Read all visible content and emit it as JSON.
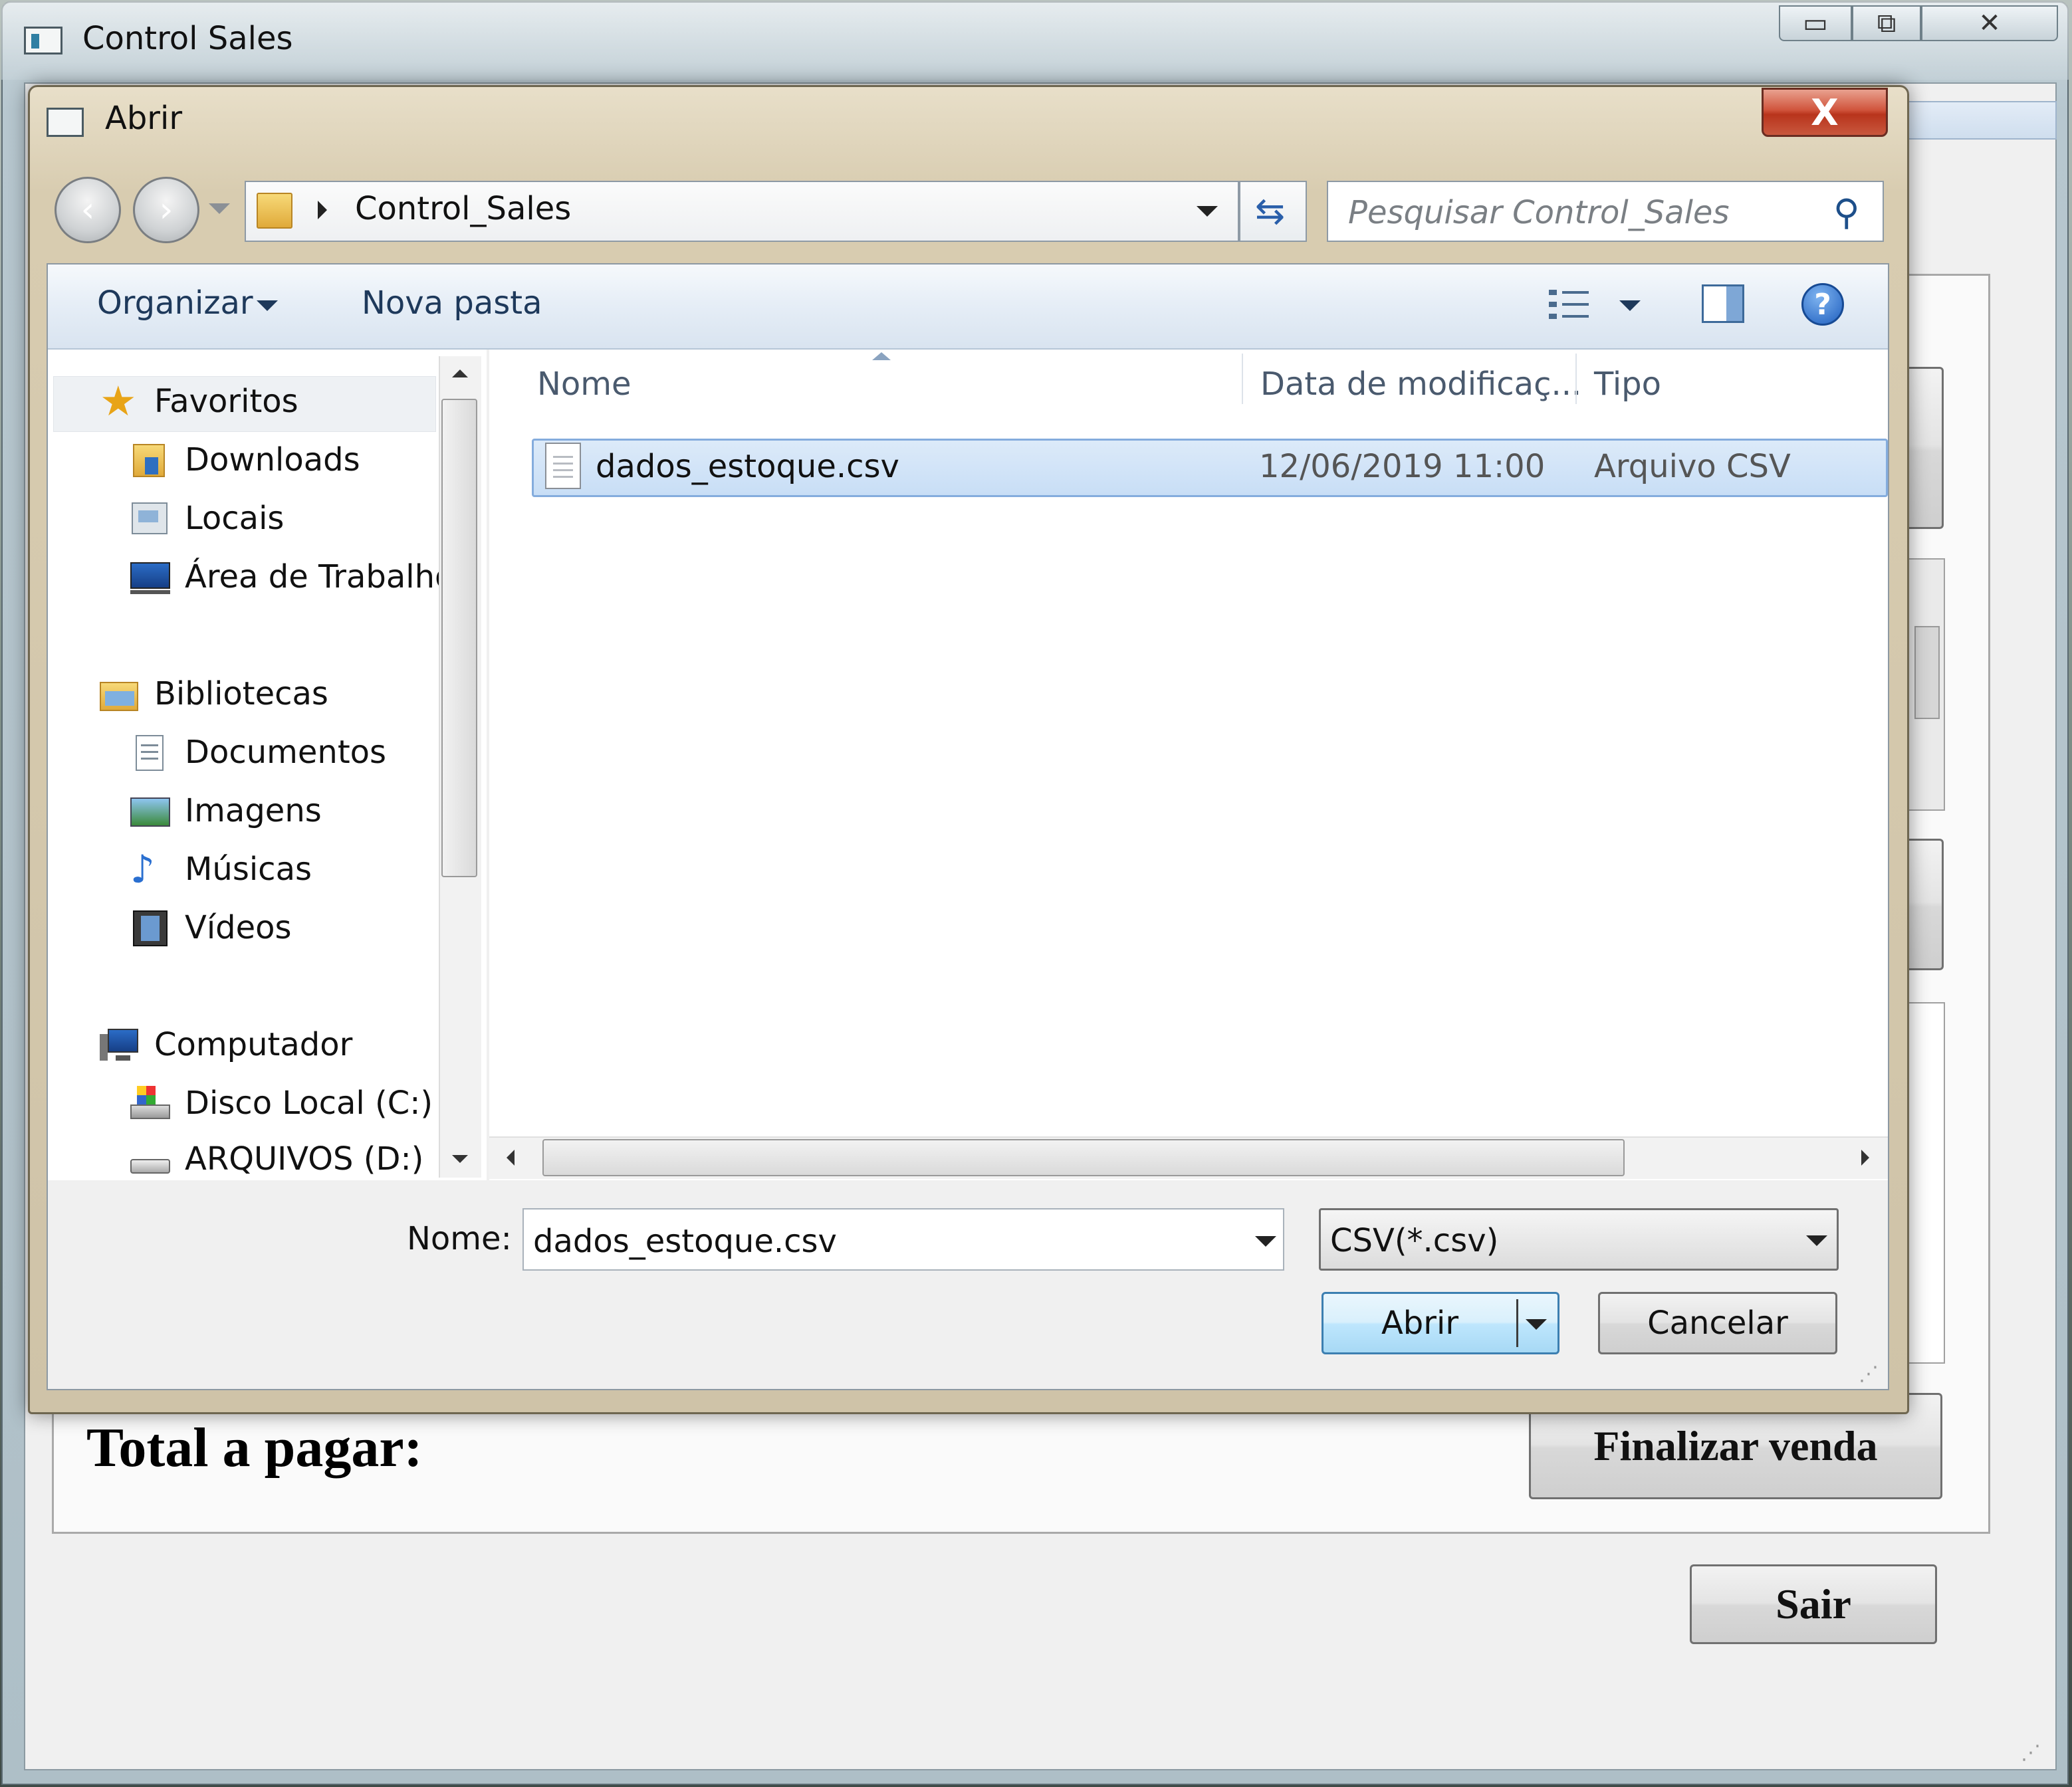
{
  "main_window": {
    "title": "Control Sales",
    "caption_buttons": {
      "minimize": "▭",
      "maximize": "⧉",
      "close": "✕"
    },
    "total_label": "Total a pagar:",
    "finalize_button": "Finalizar venda",
    "exit_button": "Sair"
  },
  "dialog": {
    "title": "Abrir",
    "close_glyph": "X",
    "breadcrumb": "Control_Sales",
    "search_placeholder": "Pesquisar Control_Sales",
    "toolbar": {
      "organize": "Organizar",
      "new_folder": "Nova pasta"
    },
    "nav": {
      "favorites": {
        "label": "Favoritos",
        "items": [
          "Downloads",
          "Locais",
          "Área de Trabalho"
        ]
      },
      "libraries": {
        "label": "Bibliotecas",
        "items": [
          "Documentos",
          "Imagens",
          "Músicas",
          "Vídeos"
        ]
      },
      "computer": {
        "label": "Computador",
        "items": [
          "Disco Local (C:)",
          "ARQUIVOS (D:)"
        ]
      }
    },
    "columns": {
      "name": "Nome",
      "date": "Data de modificaç...",
      "type": "Tipo"
    },
    "files": [
      {
        "name": "dados_estoque.csv",
        "date": "12/06/2019 11:00",
        "type": "Arquivo CSV",
        "selected": true
      }
    ],
    "filename_label": "Nome:",
    "filename_value": "dados_estoque.csv",
    "filter_value": "CSV(*.csv)",
    "open_button": "Abrir",
    "cancel_button": "Cancelar"
  },
  "colors": {
    "selection_fill": "#c8def6",
    "selection_border": "#84acdd",
    "command_text": "#1e395b",
    "close_red": "#c9583e"
  },
  "icons": [
    "app-icon",
    "back-arrow-icon",
    "forward-arrow-icon",
    "folder-icon",
    "refresh-icon",
    "search-icon",
    "view-list-icon",
    "preview-pane-icon",
    "help-icon",
    "star-icon",
    "downloads-folder-icon",
    "recent-places-icon",
    "desktop-icon",
    "libraries-icon",
    "documents-icon",
    "pictures-icon",
    "music-icon",
    "videos-icon",
    "computer-icon",
    "local-disk-icon",
    "drive-icon",
    "csv-file-icon"
  ]
}
